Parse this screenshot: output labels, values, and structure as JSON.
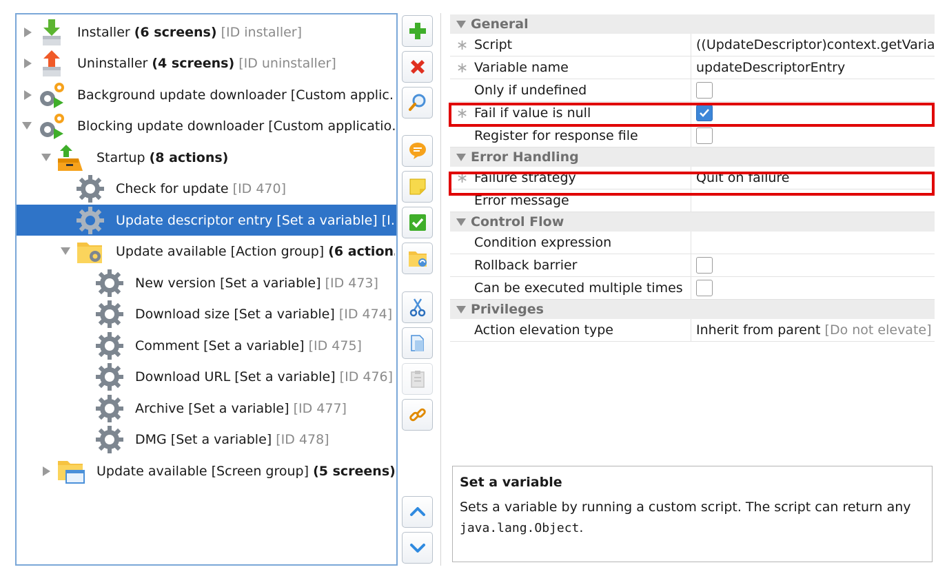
{
  "tree": {
    "items": [
      {
        "label": "Installer",
        "bold": "(6 screens)",
        "id": "[ID installer]"
      },
      {
        "label": "Uninstaller",
        "bold": "(4 screens)",
        "id": "[ID uninstaller]"
      },
      {
        "label": "Background update downloader [Custom applic…"
      },
      {
        "label": "Blocking update downloader [Custom applicatio…"
      },
      {
        "label": "Startup",
        "bold": "(8 actions)"
      },
      {
        "label": "Check for update",
        "id": "[ID 470]"
      },
      {
        "label": "Update descriptor entry [Set a variable] [I…"
      },
      {
        "label": "Update available [Action group]",
        "bold": "(6 action…"
      },
      {
        "label": "New version [Set a variable]",
        "id": "[ID 473]"
      },
      {
        "label": "Download size [Set a variable]",
        "id": "[ID 474]"
      },
      {
        "label": "Comment [Set a variable]",
        "id": "[ID 475]"
      },
      {
        "label": "Download URL [Set a variable]",
        "id": "[ID 476]"
      },
      {
        "label": "Archive [Set a variable]",
        "id": "[ID 477]"
      },
      {
        "label": "DMG [Set a variable]",
        "id": "[ID 478]"
      },
      {
        "label": "Update available [Screen group]",
        "bold": "(5 screens)",
        "id": "[…"
      }
    ]
  },
  "toolbar": {
    "buttons": [
      "add-icon",
      "delete-icon",
      "search-icon",
      "comment-icon",
      "note-icon",
      "check-icon",
      "folder-icon",
      "cut-icon",
      "copy-icon",
      "paste-icon",
      "link-icon",
      "move-up-icon",
      "move-down-icon"
    ]
  },
  "properties": {
    "general": {
      "title": "General",
      "script_key": "Script",
      "script_val": "((UpdateDescriptor)context.getVariabl",
      "varname_key": "Variable name",
      "varname_val": "updateDescriptorEntry",
      "only_undef_key": "Only if undefined",
      "only_undef_checked": false,
      "fail_null_key": "Fail if value is null",
      "fail_null_checked": true,
      "register_key": "Register for response file",
      "register_checked": false
    },
    "error": {
      "title": "Error Handling",
      "strategy_key": "Failure strategy",
      "strategy_val": "Quit on failure",
      "message_key": "Error message",
      "message_val": ""
    },
    "control": {
      "title": "Control Flow",
      "condition_key": "Condition expression",
      "condition_val": "",
      "rollback_key": "Rollback barrier",
      "rollback_checked": false,
      "multiple_key": "Can be executed multiple times",
      "multiple_checked": false
    },
    "privileges": {
      "title": "Privileges",
      "elevation_key": "Action elevation type",
      "elevation_val": "Inherit from parent",
      "elevation_hint": "[Do not elevate]"
    }
  },
  "description": {
    "title": "Set a variable",
    "text": "Sets a variable by running a custom script. The script can return any",
    "code": "java.lang.Object",
    "suffix": "."
  },
  "colors": {
    "selection": "#2f74c8",
    "highlight": "#e00000",
    "checkbox": "#3c86d8"
  }
}
